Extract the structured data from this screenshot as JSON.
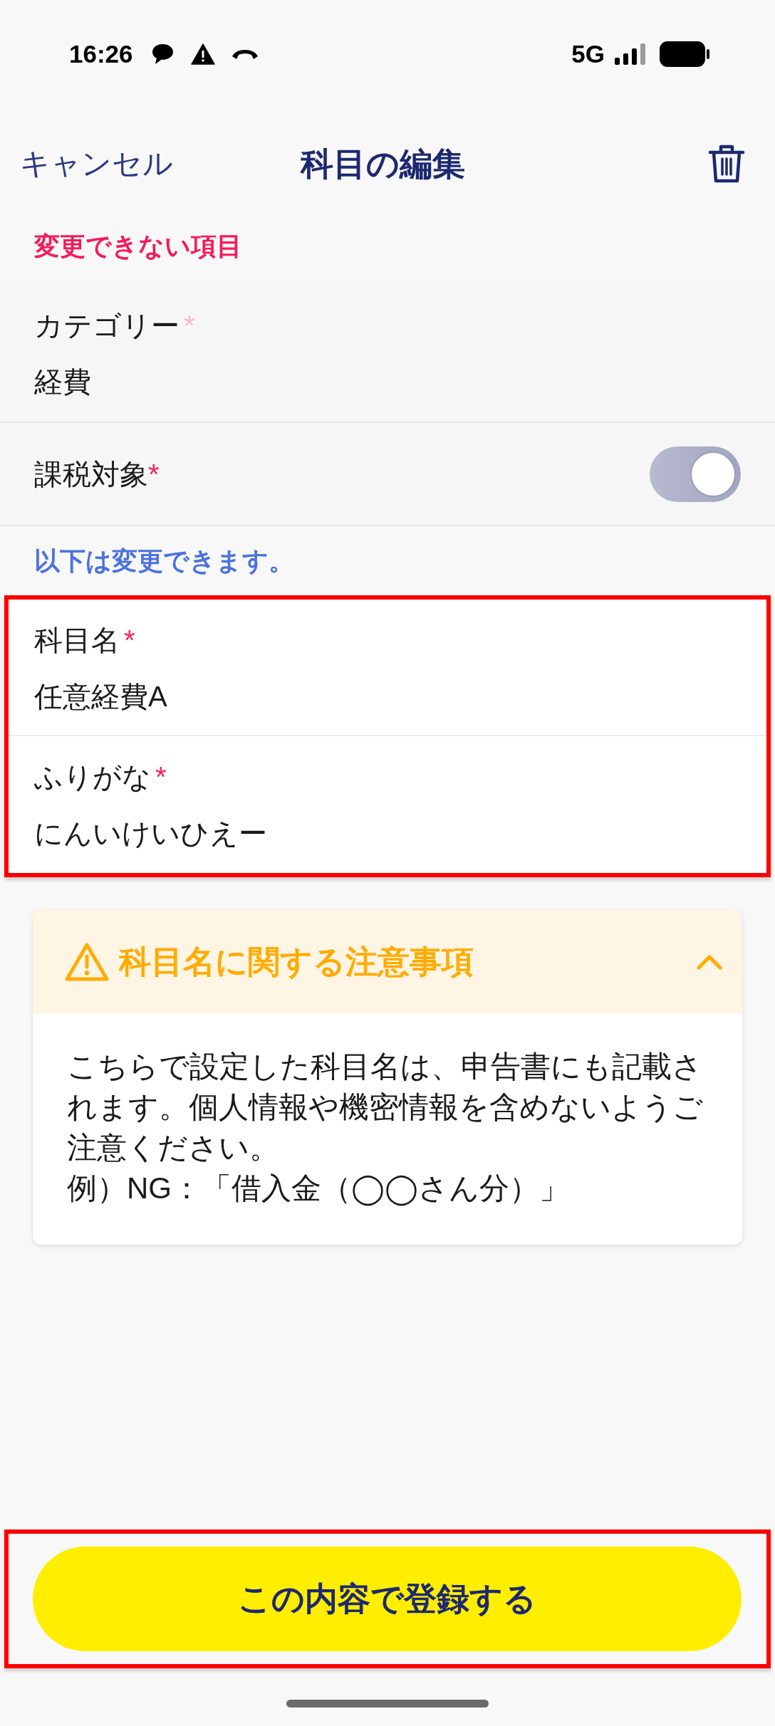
{
  "status_bar": {
    "time": "16:26",
    "network": "5G"
  },
  "nav": {
    "cancel": "キャンセル",
    "title": "科目の編集"
  },
  "locked": {
    "heading": "変更できない項目",
    "fields": [
      {
        "kind": "text",
        "label": "カテゴリー",
        "mark": "*",
        "disabled": true,
        "value": "経費"
      },
      {
        "kind": "toggle",
        "label": "課税対象",
        "mark": "*",
        "disabled": true,
        "on": true
      }
    ]
  },
  "editable": {
    "heading": "以下は変更できます。",
    "highlighted": true,
    "fields": [
      {
        "label": "科目名",
        "mark": "*",
        "value": "任意経費A"
      },
      {
        "label": "ふりがな",
        "mark": "*",
        "value": "にんいけいひえー"
      }
    ]
  },
  "notice": {
    "title": "科目名に関する注意事項",
    "expanded": true,
    "paragraphs": [
      "こちらで設定した科目名は、申告書にも記載されます。個人情報や機密情報を含めないようご注意ください。",
      "例）NG：「借入金（◯◯さん分）」"
    ]
  },
  "footer": {
    "highlighted": true,
    "submit": "この内容で登録する"
  }
}
